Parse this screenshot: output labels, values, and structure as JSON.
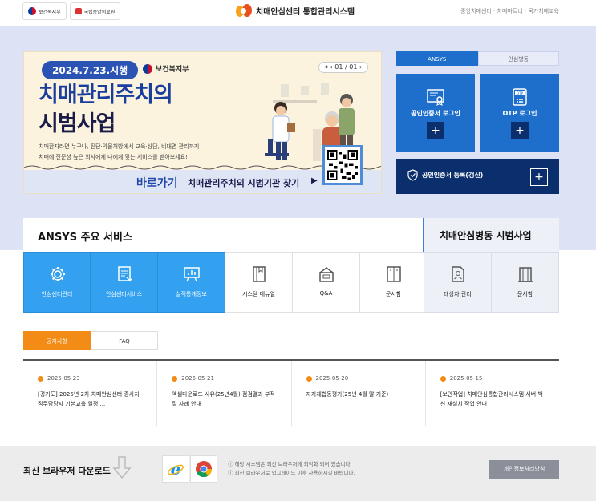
{
  "header": {
    "gov_logo_1": "보건복지부",
    "gov_logo_2": "국립중앙의료원",
    "site_title": "치매안심센터 통합관리시스템",
    "links": "중앙치매센터 · 치매파트너 · 국가치매교육"
  },
  "banner": {
    "date_pill": "2024.7.23.시행",
    "ministry": "보건복지부",
    "pager": "⏸ ‹ 01 / 01 ›",
    "title_line1": "치매관리주치의",
    "title_line2": "시범사업",
    "desc_line1": "치매환자라면 누구나, 진단·약물처방에서 교육·상담, 비대면 관리까지",
    "desc_line2": "치매에 전문성 높은 의사에게 나에게 맞는 서비스를 받아보세요!",
    "cta_go": "바로가기",
    "cta_label": "치매관리주치의 시범기관 찾기",
    "cta_arrow": "▶"
  },
  "login": {
    "tabs": [
      {
        "label": "ANSYS",
        "active": true
      },
      {
        "label": "안심병동",
        "active": false
      }
    ],
    "cert_login": "공인인증서 로그인",
    "otp_login": "OTP 로그인",
    "plus": "+",
    "register": "공인인증서 등록(갱신)"
  },
  "services": {
    "title": "ANSYS 주요 서비스",
    "title2": "치매안심병동 시범사업",
    "tiles": [
      {
        "label": "안심센터관리",
        "icon": "gear-icon"
      },
      {
        "label": "안심센터서비스",
        "icon": "document-icon"
      },
      {
        "label": "실적통계정보",
        "icon": "chart-board-icon"
      },
      {
        "label": "시스템 메뉴얼",
        "icon": "book-icon"
      },
      {
        "label": "Q&A",
        "icon": "inbox-icon"
      },
      {
        "label": "문서함",
        "icon": "folder-icon"
      }
    ],
    "tiles2": [
      {
        "label": "대상자 관리",
        "icon": "person-doc-icon"
      },
      {
        "label": "문서함",
        "icon": "building-icon"
      }
    ]
  },
  "notice_tabs": [
    {
      "label": "공지사항",
      "active": true
    },
    {
      "label": "FAQ",
      "active": false
    }
  ],
  "notices": [
    {
      "date": "2025-05-23",
      "title": "[경기도] 2025년 2차 치매안심센터 종사자 직무담당자 기본교육 일정 ..."
    },
    {
      "date": "2025-05-21",
      "title": "엑셀다운로드 사유(25년4월) 점검결과 부적절 사례 안내"
    },
    {
      "date": "2025-05-20",
      "title": "지자체합동평가(25년 4월 말 기준)"
    },
    {
      "date": "2025-05-15",
      "title": "[보안작업] 치매안심통합관리시스템 서버 백신 재설치 작업 안내"
    }
  ],
  "footer": {
    "browser_title": "최신 브라우저 다운로드",
    "note1": "ⓘ 해당 시스템은 최신 브라우저에 최적화 되어 있습니다.",
    "note2": "ⓘ 최신 브라우저로 업그레이드 이후 사용하시길 바랍니다.",
    "privacy": "개인정보처리방침"
  },
  "colors": {
    "primary": "#1d6fcb",
    "navy": "#0b2f6c",
    "orange": "#f28c16",
    "sky": "#33a1f0"
  }
}
